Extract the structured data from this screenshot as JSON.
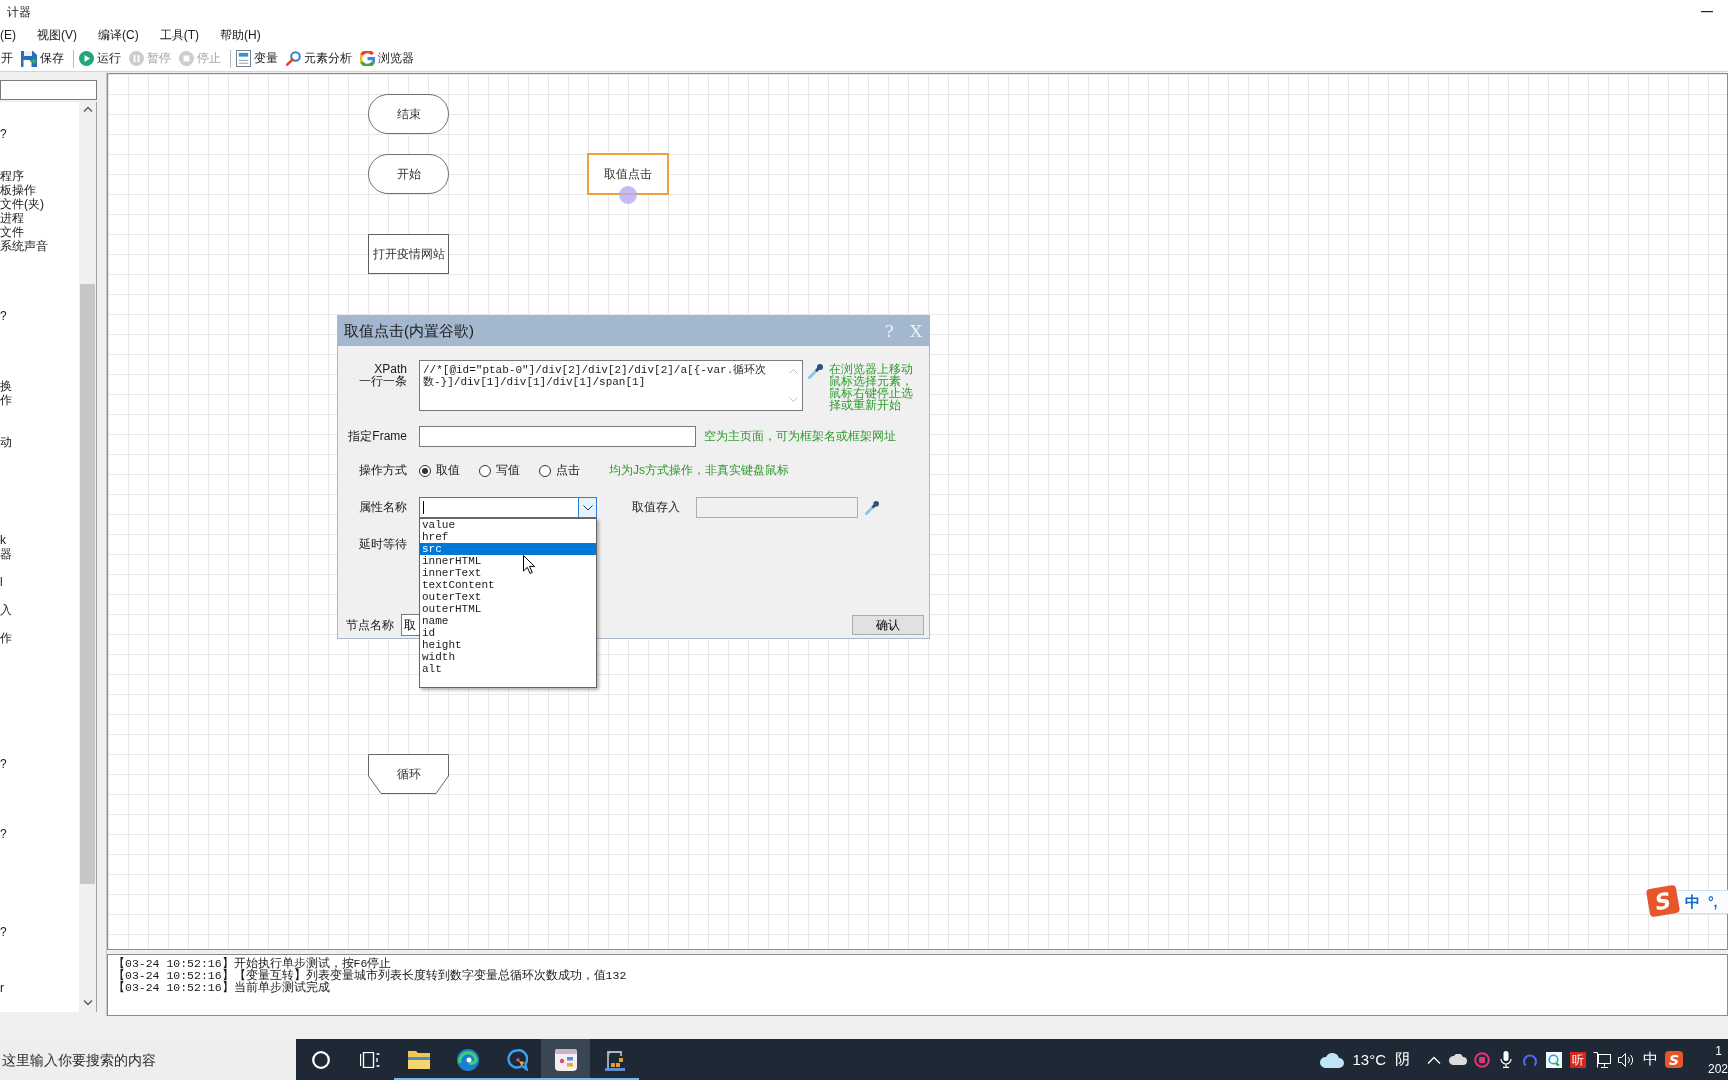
{
  "window": {
    "title": "计器"
  },
  "menu": [
    {
      "label": "(E)"
    },
    {
      "label": "视图(V)"
    },
    {
      "label": "编译(C)"
    },
    {
      "label": "工具(T)"
    },
    {
      "label": "帮助(H)"
    }
  ],
  "toolbar": [
    {
      "kind": "open",
      "label": "开",
      "disabled": false
    },
    {
      "kind": "save",
      "label": "保存",
      "disabled": false
    },
    {
      "kind": "separator"
    },
    {
      "kind": "run",
      "label": "运行",
      "disabled": false
    },
    {
      "kind": "pause",
      "label": "暂停",
      "disabled": true
    },
    {
      "kind": "stop",
      "label": "停止",
      "disabled": true
    },
    {
      "kind": "separator"
    },
    {
      "kind": "variable",
      "label": "变量",
      "disabled": false
    },
    {
      "kind": "analyze",
      "label": "元素分析",
      "disabled": false
    },
    {
      "kind": "browser",
      "label": "浏览器",
      "disabled": false
    }
  ],
  "sidebar": {
    "items": [
      {
        "label": "?"
      },
      {
        "label": "程序"
      },
      {
        "label": "板操作"
      },
      {
        "label": "文件(夹)"
      },
      {
        "label": "进程"
      },
      {
        "label": "文件"
      },
      {
        "label": "系统声音"
      },
      {
        "label": "?"
      },
      {
        "label": "换"
      },
      {
        "label": "作"
      },
      {
        "label": "动"
      },
      {
        "label": "k"
      },
      {
        "label": "器"
      },
      {
        "label": "l"
      },
      {
        "label": "入"
      },
      {
        "label": "作"
      },
      {
        "label": "?"
      },
      {
        "label": "?"
      },
      {
        "label": "?"
      },
      {
        "label": "r"
      }
    ]
  },
  "canvas": {
    "nodes": [
      {
        "label": "结束",
        "kind": "terminal",
        "selected": false
      },
      {
        "label": "开始",
        "kind": "terminal",
        "selected": false
      },
      {
        "label": "取值点击",
        "kind": "process",
        "selected": true
      },
      {
        "label": "打开疫情网站",
        "kind": "process",
        "selected": false
      },
      {
        "label": "循环",
        "kind": "loop",
        "selected": false
      }
    ]
  },
  "dialog": {
    "title": "取值点击(内置谷歌)",
    "help": "?",
    "close": "X",
    "xpath": {
      "label": "XPath",
      "sublabel": "一行一条",
      "value": "//*[@id=\"ptab-0\"]/div[2]/div[2]/div[2]/a[{-var.循环次数-}]/div[1]/div[1]/div[1]/span[1]",
      "hint": "在浏览器上移动鼠标选择元素，鼠标右键停止选择或重新开始"
    },
    "frame": {
      "label": "指定Frame",
      "hint": "空为主页面，可为框架名或框架网址"
    },
    "mode": {
      "label": "操作方式",
      "options": [
        {
          "label": "取值",
          "selected": true
        },
        {
          "label": "写值",
          "selected": false
        },
        {
          "label": "点击",
          "selected": false
        }
      ],
      "hint": "均为Js方式操作，非真实键盘鼠标"
    },
    "attribute": {
      "label": "属性名称",
      "expanded": true,
      "options": [
        {
          "label": "value",
          "selected": false
        },
        {
          "label": "href",
          "selected": false
        },
        {
          "label": "src",
          "selected": true
        },
        {
          "label": "innerHTML",
          "selected": false
        },
        {
          "label": "innerText",
          "selected": false
        },
        {
          "label": "textContent",
          "selected": false
        },
        {
          "label": "outerText",
          "selected": false
        },
        {
          "label": "outerHTML",
          "selected": false
        },
        {
          "label": "name",
          "selected": false
        },
        {
          "label": "id",
          "selected": false
        },
        {
          "label": "height",
          "selected": false
        },
        {
          "label": "width",
          "selected": false
        },
        {
          "label": "alt",
          "selected": false
        }
      ]
    },
    "store": {
      "label": "取值存入",
      "disabled": true
    },
    "delay": {
      "label": "延时等待"
    },
    "node_name": {
      "label": "节点名称",
      "value": "取"
    },
    "confirm": "确认"
  },
  "log": {
    "lines": [
      "【03-24 10:52:16】开始执行单步测试，按F6停止",
      "【03-24 10:52:16】【变量互转】列表变量城市列表长度转到数字变量总循环次数成功，值132",
      "【03-24 10:52:16】当前单步测试完成"
    ]
  },
  "ime_bar": {
    "logo": "S",
    "mode": "中",
    "punctuation": "°,"
  },
  "taskbar": {
    "search": {
      "placeholder": "这里输入你要搜索的内容"
    },
    "apps": [
      {
        "kind": "search",
        "running": false,
        "active": false
      },
      {
        "kind": "taskview",
        "running": false,
        "active": false
      },
      {
        "kind": "files",
        "running": true,
        "active": false
      },
      {
        "kind": "edge",
        "running": true,
        "active": false
      },
      {
        "kind": "chat",
        "running": true,
        "active": false
      },
      {
        "kind": "designer",
        "running": true,
        "active": true
      },
      {
        "kind": "crane",
        "running": true,
        "active": false
      }
    ],
    "weather": {
      "temperature": "13°C",
      "condition": "阴"
    },
    "tray": [
      {
        "kind": "chevron"
      },
      {
        "kind": "cloud"
      },
      {
        "kind": "record"
      },
      {
        "kind": "mic"
      },
      {
        "kind": "ring"
      },
      {
        "kind": "capture"
      },
      {
        "kind": "listen",
        "text": "听"
      },
      {
        "kind": "network"
      },
      {
        "kind": "volume"
      },
      {
        "kind": "ime",
        "text": "中"
      },
      {
        "kind": "logo",
        "text": "S"
      }
    ],
    "clock": {
      "time": "1",
      "date": "202"
    }
  }
}
